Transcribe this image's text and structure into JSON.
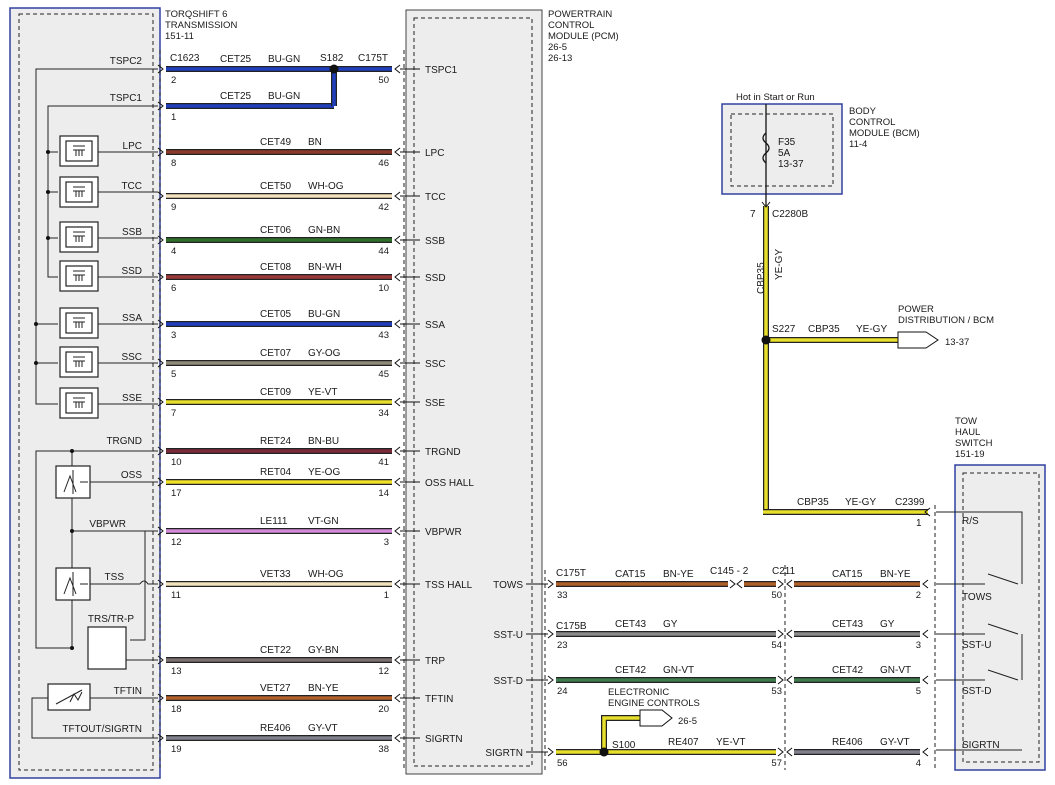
{
  "transmission": {
    "title": "TORQSHIFT 6",
    "subtitle": "TRANSMISSION",
    "ref": "151-11"
  },
  "pcm": {
    "line1": "POWERTRAIN",
    "line2": "CONTROL",
    "line3": "MODULE (PCM)",
    "ref1": "26-5",
    "ref2": "26-13"
  },
  "bcm": {
    "line1": "BODY",
    "line2": "CONTROL",
    "line3": "MODULE (BCM)",
    "ref": "11-4",
    "hot_label": "Hot in Start or Run",
    "fuse": "F35",
    "fuse_rating": "5A",
    "fuse_ref": "13-37",
    "pin": "7",
    "connector": "C2280B"
  },
  "power_dist": {
    "line1": "POWER",
    "line2": "DISTRIBUTION / BCM",
    "ref": "13-37"
  },
  "tow_haul": {
    "line1": "TOW",
    "line2": "HAUL",
    "line3": "SWITCH",
    "ref": "151-19",
    "rs": "R/S",
    "tows": "TOWS",
    "sstu": "SST-U",
    "sstd": "SST-D",
    "sigrtn": "SIGRTN"
  },
  "eec": {
    "line1": "ELECTRONIC",
    "line2": "ENGINE CONTROLS",
    "ref": "26-5"
  },
  "colors": {
    "BU": "#1f3fbf",
    "BN": "#8a3a2a",
    "WH-OG": "#f0dcb0",
    "GN": "#2f7a2f",
    "GY": "#8a8a8a",
    "YE": "#e8df2a",
    "VT": "#d28ad6",
    "BN-YE": "#b0602a",
    "GN-VT": "#3f7a4f",
    "GY-VT": "#6f6f7a"
  },
  "splices": {
    "s182": "S182",
    "s227": "S227",
    "s100": "S100"
  },
  "conn": {
    "c1623": "C1623",
    "c175t": "C175T",
    "c175b": "C175B",
    "c145": "C145 - 2",
    "c211": "C211",
    "c2399": "C2399"
  },
  "sensor_labels": {
    "oss": "OSS",
    "tss": "TSS",
    "trs": "TRS/TR-P",
    "tftin": "TFTIN",
    "tftout": "TFTOUT/SIGRTN",
    "trgnd": "TRGND",
    "vbpwr": "VBPWR"
  },
  "circuits": [
    {
      "left": "TSPC2",
      "circuit": "CET25",
      "color": "BU-GN",
      "pin_t": "2",
      "pin_p": "50",
      "pcm": "TSPC1"
    },
    {
      "left": "TSPC1",
      "circuit": "CET25",
      "color": "BU-GN",
      "pin_t": "1",
      "pin_p": "",
      "pcm": ""
    },
    {
      "left": "LPC",
      "circuit": "CET49",
      "color": "BN",
      "pin_t": "8",
      "pin_p": "46",
      "pcm": "LPC"
    },
    {
      "left": "TCC",
      "circuit": "CET50",
      "color": "WH-OG",
      "pin_t": "9",
      "pin_p": "42",
      "pcm": "TCC"
    },
    {
      "left": "SSB",
      "circuit": "CET06",
      "color": "GN-BN",
      "pin_t": "4",
      "pin_p": "44",
      "pcm": "SSB"
    },
    {
      "left": "SSD",
      "circuit": "CET08",
      "color": "BN-WH",
      "pin_t": "6",
      "pin_p": "10",
      "pcm": "SSD"
    },
    {
      "left": "SSA",
      "circuit": "CET05",
      "color": "BU-GN",
      "pin_t": "3",
      "pin_p": "43",
      "pcm": "SSA"
    },
    {
      "left": "SSC",
      "circuit": "CET07",
      "color": "GY-OG",
      "pin_t": "5",
      "pin_p": "45",
      "pcm": "SSC"
    },
    {
      "left": "SSE",
      "circuit": "CET09",
      "color": "YE-VT",
      "pin_t": "7",
      "pin_p": "34",
      "pcm": "SSE"
    },
    {
      "left": "TRGND",
      "circuit": "RET24",
      "color": "BN-BU",
      "pin_t": "10",
      "pin_p": "41",
      "pcm": "TRGND"
    },
    {
      "left": "OSS",
      "circuit": "RET04",
      "color": "YE-OG",
      "pin_t": "17",
      "pin_p": "14",
      "pcm": "OSS HALL"
    },
    {
      "left": "VBPWR",
      "circuit": "LE111",
      "color": "VT-GN",
      "pin_t": "12",
      "pin_p": "3",
      "pcm": "VBPWR"
    },
    {
      "left": "TSS",
      "circuit": "VET33",
      "color": "WH-OG",
      "pin_t": "11",
      "pin_p": "1",
      "pcm": "TSS HALL"
    },
    {
      "left": "",
      "circuit": "CET22",
      "color": "GY-BN",
      "pin_t": "13",
      "pin_p": "12",
      "pcm": "TRP"
    },
    {
      "left": "TFTIN",
      "circuit": "VET27",
      "color": "BN-YE",
      "pin_t": "18",
      "pin_p": "20",
      "pcm": "TFTIN"
    },
    {
      "left": "TFTOUT/SIGRTN",
      "circuit": "RE406",
      "color": "GY-VT",
      "pin_t": "19",
      "pin_p": "38",
      "pcm": "SIGRTN"
    }
  ],
  "right_circuits": [
    {
      "pcm": "TOWS",
      "pin_p": "33",
      "c1": "CAT15",
      "col1": "BN-YE",
      "pin_mid": "50",
      "c2": "CAT15",
      "col2": "BN-YE",
      "pin_s": "2"
    },
    {
      "pcm": "SST-U",
      "pin_p": "23",
      "c1": "CET43",
      "col1": "GY",
      "pin_mid": "54",
      "c2": "CET43",
      "col2": "GY",
      "pin_s": "3"
    },
    {
      "pcm": "SST-D",
      "pin_p": "24",
      "c1": "CET42",
      "col1": "GN-VT",
      "pin_mid": "53",
      "c2": "CET42",
      "col2": "GN-VT",
      "pin_s": "5"
    },
    {
      "pcm": "SIGRTN",
      "pin_p": "56",
      "c1": "RE407",
      "col1": "YE-VT",
      "pin_mid": "57",
      "c2": "RE406",
      "col2": "GY-VT",
      "pin_s": "4"
    }
  ],
  "bcm_wires": {
    "vertical_circuit": "CBP35",
    "vertical_color": "YE-GY",
    "branch_circuit": "CBP35",
    "branch_color": "YE-GY",
    "bottom_circuit": "CBP35",
    "bottom_color": "YE-GY",
    "c2399_pin": "1"
  }
}
